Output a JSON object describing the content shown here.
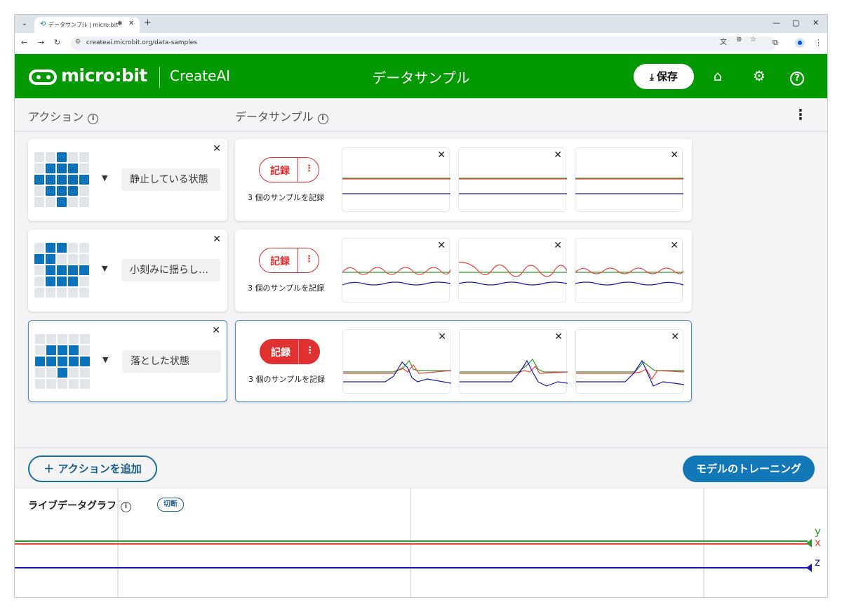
{
  "browser": {
    "tab_title": "データサンプル | micro:bit CreateAI",
    "url": "createai.microbit.org/data-samples"
  },
  "header": {
    "logo_text": "micro:bit",
    "product": "CreateAI",
    "page_title": "データサンプル",
    "save_label": "保存"
  },
  "columns": {
    "actions_label": "アクション",
    "samples_label": "データサンプル"
  },
  "actions": [
    {
      "name": "静止している状態",
      "record_label": "記録",
      "sample_count": "3 個のサンプルを記録",
      "led": [
        0,
        0,
        1,
        0,
        0,
        0,
        1,
        1,
        1,
        0,
        1,
        1,
        1,
        1,
        1,
        0,
        1,
        1,
        1,
        0,
        0,
        0,
        1,
        0,
        0
      ]
    },
    {
      "name": "小刻みに揺らし…",
      "record_label": "記録",
      "sample_count": "3 個のサンプルを記録",
      "led": [
        0,
        1,
        1,
        0,
        0,
        1,
        1,
        0,
        0,
        0,
        0,
        1,
        1,
        1,
        1,
        0,
        1,
        1,
        1,
        0,
        0,
        0,
        0,
        0,
        0
      ]
    },
    {
      "name": "落とした状態",
      "record_label": "記録",
      "sample_count": "3 個のサンプルを記録",
      "led": [
        0,
        0,
        0,
        0,
        0,
        0,
        1,
        1,
        1,
        0,
        1,
        1,
        1,
        1,
        1,
        0,
        0,
        1,
        0,
        0,
        0,
        0,
        0,
        0,
        0
      ]
    }
  ],
  "footer": {
    "add_action_label": "アクションを追加",
    "train_label": "モデルのトレーニング"
  },
  "live": {
    "title": "ライブデータグラフ",
    "disconnect_label": "切断",
    "axis_y": "y",
    "axis_x": "x",
    "axis_z": "z"
  },
  "colors": {
    "brand_green": "#039902",
    "record_red": "#e0302f",
    "primary_blue": "#1278b8",
    "series_x": "#e8453c",
    "series_y": "#2e9a2e",
    "series_z": "#1a1aa8"
  }
}
